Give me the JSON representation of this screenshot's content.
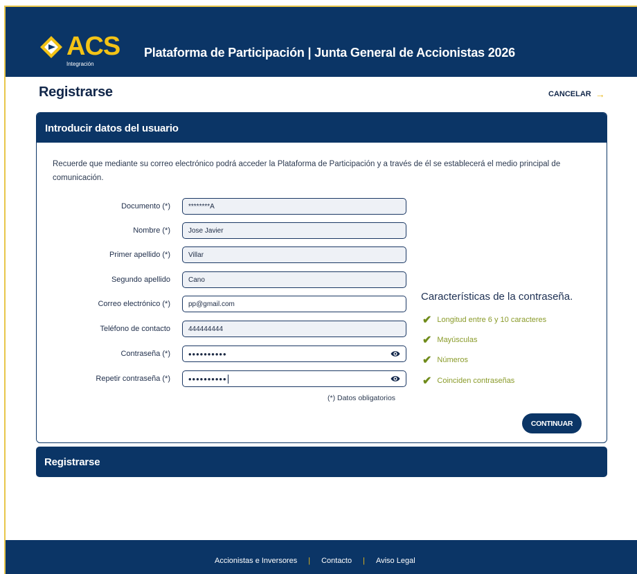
{
  "header": {
    "logo_text": "ACS",
    "logo_sub": "Integración",
    "title": "Plataforma de Participación | Junta General de Accionistas 2026",
    "brand_color": "#0b3566",
    "accent_color": "#f3c316"
  },
  "page": {
    "title": "Registrarse",
    "cancel_label": "CANCELAR",
    "cancel_icon": "arrow-right-icon"
  },
  "form_panel": {
    "title": "Introducir datos del usuario",
    "intro": "Recuerde que mediante su correo electrónico podrá acceder la Plataforma de Participación y a través de él se establecerá el medio principal de comunicación.",
    "fields": [
      {
        "label": "Documento (*)",
        "value": "********A"
      },
      {
        "label": "Nombre (*)",
        "value": "Jose Javier"
      },
      {
        "label": "Primer apellido (*)",
        "value": "Villar"
      },
      {
        "label": "Segundo apellido",
        "value": "Cano"
      },
      {
        "label": "Correo electrónico (*)",
        "value": "pp@gmail.com"
      },
      {
        "label": "Teléfono de contacto",
        "value": "444444444"
      },
      {
        "label": "Contraseña (*)",
        "value": "••••••••••"
      },
      {
        "label": "Repetir contraseña (*)",
        "value": "••••••••••"
      }
    ],
    "required_note": "(*) Datos obligatorios",
    "password_rules_title": "Características de la contraseña.",
    "password_rules": [
      "Longitud entre 6 y 10 caracteres",
      "Mayúsculas",
      "Números",
      "Coinciden contraseñas"
    ],
    "continue_label": "CONTINUAR"
  },
  "register_panel": {
    "title": "Registrarse"
  },
  "footer": {
    "links": [
      "Accionistas e Inversores",
      "Contacto",
      "Aviso Legal"
    ],
    "separator": "|"
  }
}
